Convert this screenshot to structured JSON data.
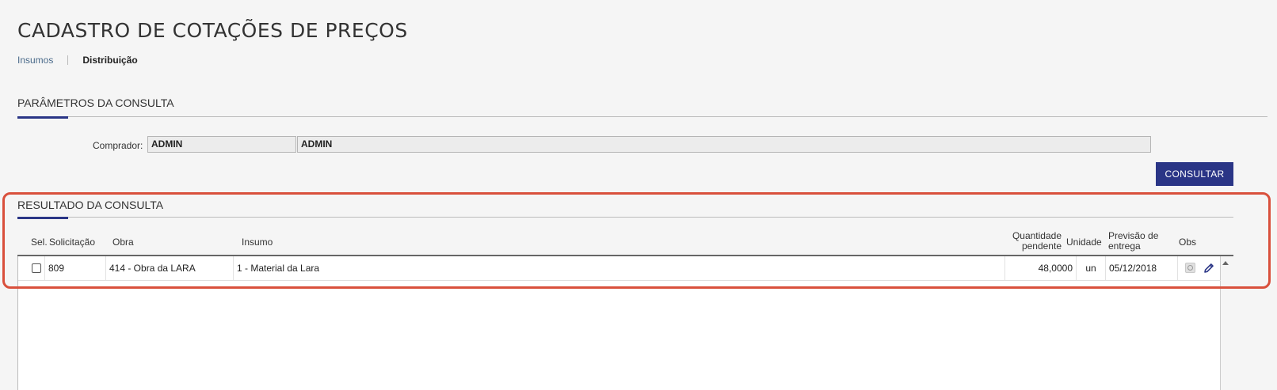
{
  "page": {
    "title": "CADASTRO DE COTAÇÕES DE PREÇOS"
  },
  "breadcrumb": {
    "items": [
      {
        "label": "Insumos"
      },
      {
        "label": "Distribuição"
      }
    ]
  },
  "params": {
    "section_title": "PARÂMETROS DA CONSULTA",
    "comprador_label": "Comprador:",
    "comprador_code": "ADMIN",
    "comprador_name": "ADMIN",
    "consultar_label": "CONSULTAR"
  },
  "results": {
    "section_title": "RESULTADO DA CONSULTA",
    "columns": {
      "sel": "Sel.",
      "solicitacao": "Solicitação",
      "obra": "Obra",
      "insumo": "Insumo",
      "quantidade_1": "Quantidade",
      "quantidade_2": "pendente",
      "unidade": "Unidade",
      "previsao_1": "Previsão de",
      "previsao_2": "entrega",
      "obs": "Obs"
    },
    "rows": [
      {
        "solicitacao": "809",
        "obra": "414 - Obra da LARA",
        "insumo": "1 - Material da Lara",
        "quantidade": "48,0000",
        "unidade": "un",
        "previsao": "05/12/2018"
      }
    ]
  },
  "colors": {
    "accent": "#2a3586",
    "highlight": "#d9503c"
  },
  "icons": {
    "obs": "magnifier-icon",
    "edit": "pencil-icon",
    "scroll": "scroll-up-arrow-icon"
  }
}
